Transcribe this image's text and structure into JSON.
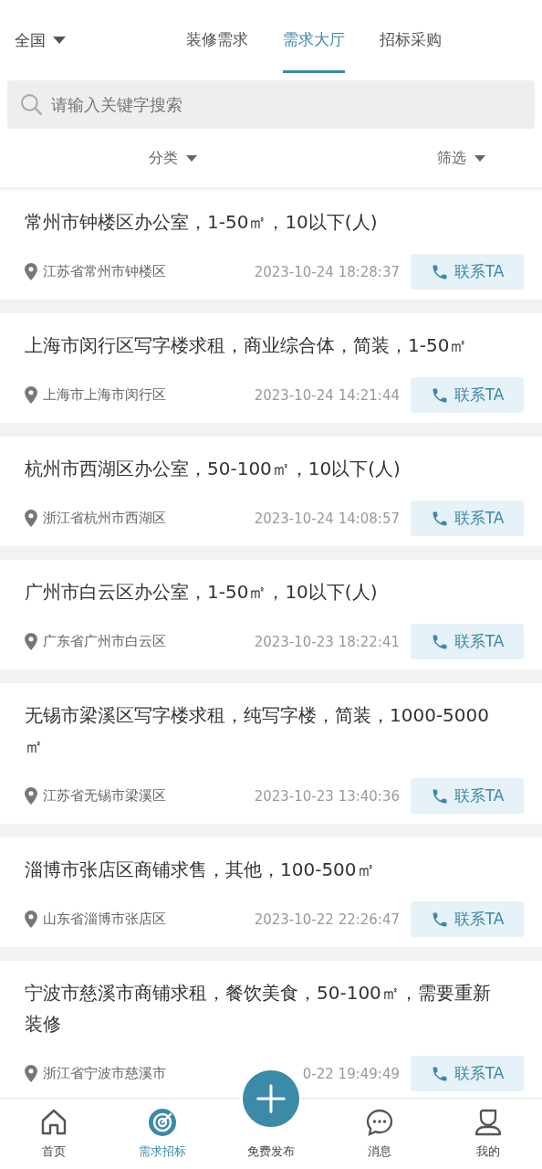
{
  "region": {
    "label": "全国"
  },
  "tabs": [
    {
      "label": "装修需求",
      "selected": false
    },
    {
      "label": "需求大厅",
      "selected": true
    },
    {
      "label": "招标采购",
      "selected": false
    }
  ],
  "search": {
    "placeholder": "请输入关键字搜索"
  },
  "filters": [
    "分类",
    "筛选"
  ],
  "listings": [
    {
      "title": "常州市钟楼区办公室，1-50㎡，10以下(人)",
      "location": "江苏省常州市钟楼区",
      "date": "2023-10-24 18:28:37",
      "action": "联系TA"
    },
    {
      "title": "上海市闵行区写字楼求租，商业综合体，简装，1-50㎡",
      "location": "上海市上海市闵行区",
      "date": "2023-10-24 14:21:44",
      "action": "联系TA"
    },
    {
      "title": "杭州市西湖区办公室，50-100㎡，10以下(人)",
      "location": "浙江省杭州市西湖区",
      "date": "2023-10-24 14:08:57",
      "action": "联系TA"
    },
    {
      "title": "广州市白云区办公室，1-50㎡，10以下(人)",
      "location": "广东省广州市白云区",
      "date": "2023-10-23 18:22:41",
      "action": "联系TA"
    },
    {
      "title": "无锡市梁溪区写字楼求租，纯写字楼，简装，1000-5000㎡",
      "location": "江苏省无锡市梁溪区",
      "date": "2023-10-23 13:40:36",
      "action": "联系TA"
    },
    {
      "title": "淄博市张店区商铺求售，其他，100-500㎡",
      "location": "山东省淄博市张店区",
      "date": "2023-10-22 22:26:47",
      "action": "联系TA"
    },
    {
      "title": "宁波市慈溪市商铺求租，餐饮美食，50-100㎡，需要重新装修",
      "location": "浙江省宁波市慈溪市",
      "date": "0-22 19:49:49",
      "action": "联系TA"
    }
  ],
  "bottom_nav": [
    {
      "kind": "home",
      "label": "首页",
      "selected": false
    },
    {
      "kind": "target",
      "label": "需求招标",
      "selected": true
    },
    {
      "kind": "publish",
      "label": "免费发布",
      "selected": false
    },
    {
      "kind": "message",
      "label": "消息",
      "selected": false
    },
    {
      "kind": "profile",
      "label": "我的",
      "selected": false
    }
  ]
}
